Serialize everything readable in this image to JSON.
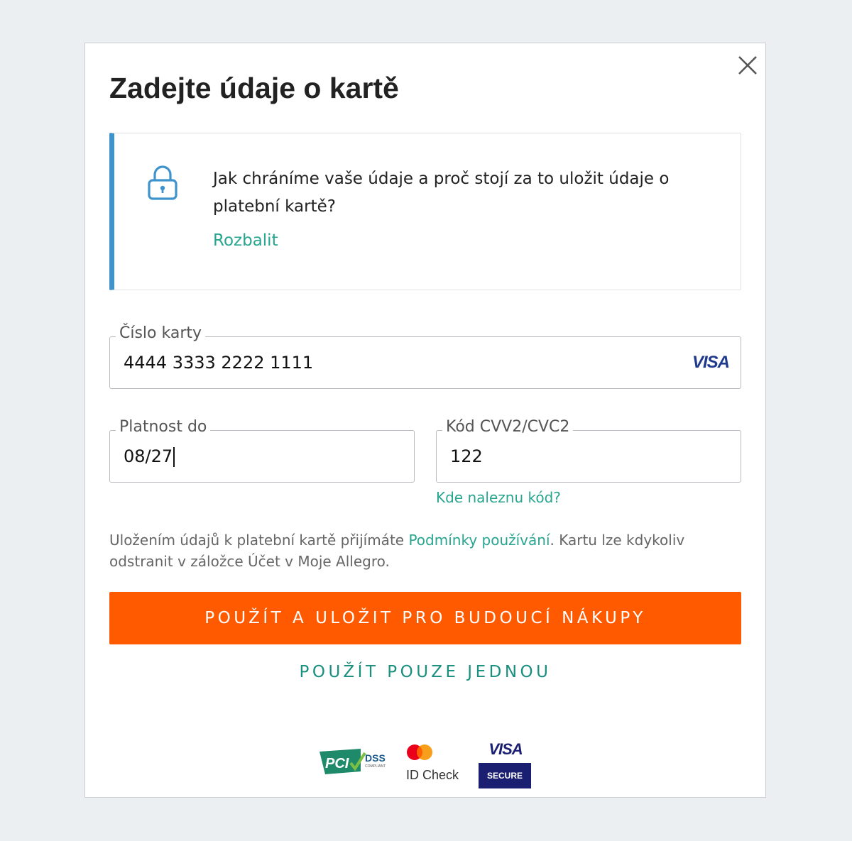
{
  "dialog": {
    "title": "Zadejte údaje o kartě",
    "close_icon": "close-icon"
  },
  "info": {
    "icon": "lock-icon",
    "text": "Jak chráníme vaše údaje a proč stojí za to uložit údaje o platební kartě?",
    "expand_label": "Rozbalit"
  },
  "card_number": {
    "label": "Číslo karty",
    "value": "4444 3333 2222 1111",
    "brand": "VISA"
  },
  "expiry": {
    "label": "Platnost do",
    "value": "08/27"
  },
  "cvv": {
    "label": "Kód CVV2/CVC2",
    "value": "122",
    "help_link": "Kde naleznu kód?"
  },
  "terms": {
    "prefix": "Uložením údajů k platební kartě přijímáte ",
    "link": "Podmínky používání",
    "suffix": ". Kartu lze kdykoliv odstranit v záložce Účet v Moje Allegro."
  },
  "buttons": {
    "primary": "POUŽÍT A ULOŽIT PRO BUDOUCÍ NÁKUPY",
    "secondary": "POUŽÍT POUZE JEDNOU"
  },
  "badges": {
    "pci_dss": {
      "logo_text": "PCI",
      "label": "DSS",
      "sublabel": "COMPLIANT"
    },
    "mastercard": {
      "label": "ID Check"
    },
    "visa_secure": {
      "brand": "VISA",
      "label": "SECURE"
    }
  },
  "colors": {
    "accent": "#ff5a00",
    "link": "#27a58f",
    "info_border": "#3f93cc",
    "background": "#eceff1",
    "visa_blue": "#1a1f71"
  }
}
